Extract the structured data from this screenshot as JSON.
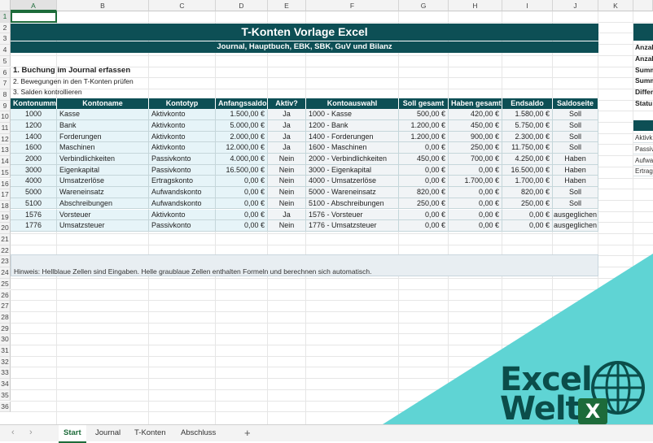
{
  "columns": [
    "A",
    "B",
    "C",
    "D",
    "E",
    "F",
    "G",
    "H",
    "I",
    "J",
    "K"
  ],
  "rows": [
    "1",
    "2",
    "3",
    "4",
    "5",
    "6",
    "7",
    "8",
    "9",
    "10",
    "11",
    "12",
    "13",
    "14",
    "15",
    "16",
    "17",
    "18",
    "19",
    "20",
    "21",
    "22",
    "23",
    "24",
    "25",
    "26",
    "27",
    "28",
    "29",
    "30",
    "31",
    "32",
    "33",
    "34",
    "35",
    "36"
  ],
  "title": "T-Konten Vorlage Excel",
  "subtitle": "Journal, Hauptbuch, EBK, SBK, GuV und Bilanz",
  "steps": [
    "1. Buchung im Journal erfassen",
    "2. Bewegungen in den T-Konten prüfen",
    "3. Salden kontrollieren"
  ],
  "table": {
    "headers": [
      "Kontonumme",
      "Kontoname",
      "Kontotyp",
      "Anfangssaldo",
      "Aktiv?",
      "Kontoauswahl",
      "Soll gesamt",
      "Haben gesamt",
      "Endsaldo",
      "Saldoseite"
    ],
    "rows": [
      [
        "1000",
        "Kasse",
        "Aktivkonto",
        "1.500,00 €",
        "Ja",
        "1000 - Kasse",
        "500,00 €",
        "420,00 €",
        "1.580,00 €",
        "Soll"
      ],
      [
        "1200",
        "Bank",
        "Aktivkonto",
        "5.000,00 €",
        "Ja",
        "1200 - Bank",
        "1.200,00 €",
        "450,00 €",
        "5.750,00 €",
        "Soll"
      ],
      [
        "1400",
        "Forderungen",
        "Aktivkonto",
        "2.000,00 €",
        "Ja",
        "1400 - Forderungen",
        "1.200,00 €",
        "900,00 €",
        "2.300,00 €",
        "Soll"
      ],
      [
        "1600",
        "Maschinen",
        "Aktivkonto",
        "12.000,00 €",
        "Ja",
        "1600 - Maschinen",
        "0,00 €",
        "250,00 €",
        "11.750,00 €",
        "Soll"
      ],
      [
        "2000",
        "Verbindlichkeiten",
        "Passivkonto",
        "4.000,00 €",
        "Nein",
        "2000 - Verbindlichkeiten",
        "450,00 €",
        "700,00 €",
        "4.250,00 €",
        "Haben"
      ],
      [
        "3000",
        "Eigenkapital",
        "Passivkonto",
        "16.500,00 €",
        "Nein",
        "3000 - Eigenkapital",
        "0,00 €",
        "0,00 €",
        "16.500,00 €",
        "Haben"
      ],
      [
        "4000",
        "Umsatzerlöse",
        "Ertragskonto",
        "0,00 €",
        "Nein",
        "4000 - Umsatzerlöse",
        "0,00 €",
        "1.700,00 €",
        "1.700,00 €",
        "Haben"
      ],
      [
        "5000",
        "Wareneinsatz",
        "Aufwandskonto",
        "0,00 €",
        "Nein",
        "5000 - Wareneinsatz",
        "820,00 €",
        "0,00 €",
        "820,00 €",
        "Soll"
      ],
      [
        "5100",
        "Abschreibungen",
        "Aufwandskonto",
        "0,00 €",
        "Nein",
        "5100 - Abschreibungen",
        "250,00 €",
        "0,00 €",
        "250,00 €",
        "Soll"
      ],
      [
        "1576",
        "Vorsteuer",
        "Aktivkonto",
        "0,00 €",
        "Ja",
        "1576 - Vorsteuer",
        "0,00 €",
        "0,00 €",
        "0,00 €",
        "ausgeglichen"
      ],
      [
        "1776",
        "Umsatzsteuer",
        "Passivkonto",
        "0,00 €",
        "Nein",
        "1776 - Umsatzsteuer",
        "0,00 €",
        "0,00 €",
        "0,00 €",
        "ausgeglichen"
      ]
    ]
  },
  "hint": "Hinweis: Hellblaue Zellen sind Eingaben. Helle graublaue Zellen enthalten Formeln und berechnen sich automatisch.",
  "side_labels_top": [
    "Anzal",
    "Anzal",
    "Summ",
    "Summ",
    "Differ",
    "Statu"
  ],
  "side_labels_bottom": [
    "Aktivk",
    "Passiv",
    "Aufwa",
    "Ertrag"
  ],
  "tabs": [
    "Start",
    "Journal",
    "T-Konten",
    "Abschluss"
  ],
  "add_tab": "+",
  "nav_prev": "‹",
  "nav_next": "›",
  "logo": {
    "line1": "Excel",
    "line2": "Welt",
    "badge": "X"
  },
  "colors": {
    "header": "#0d4f55",
    "input": "#e6f4f8",
    "formula": "#f1f4f6",
    "accent": "#1d6b3a",
    "triangle": "#5fd4d4",
    "logo_text": "#0b4d4a"
  }
}
